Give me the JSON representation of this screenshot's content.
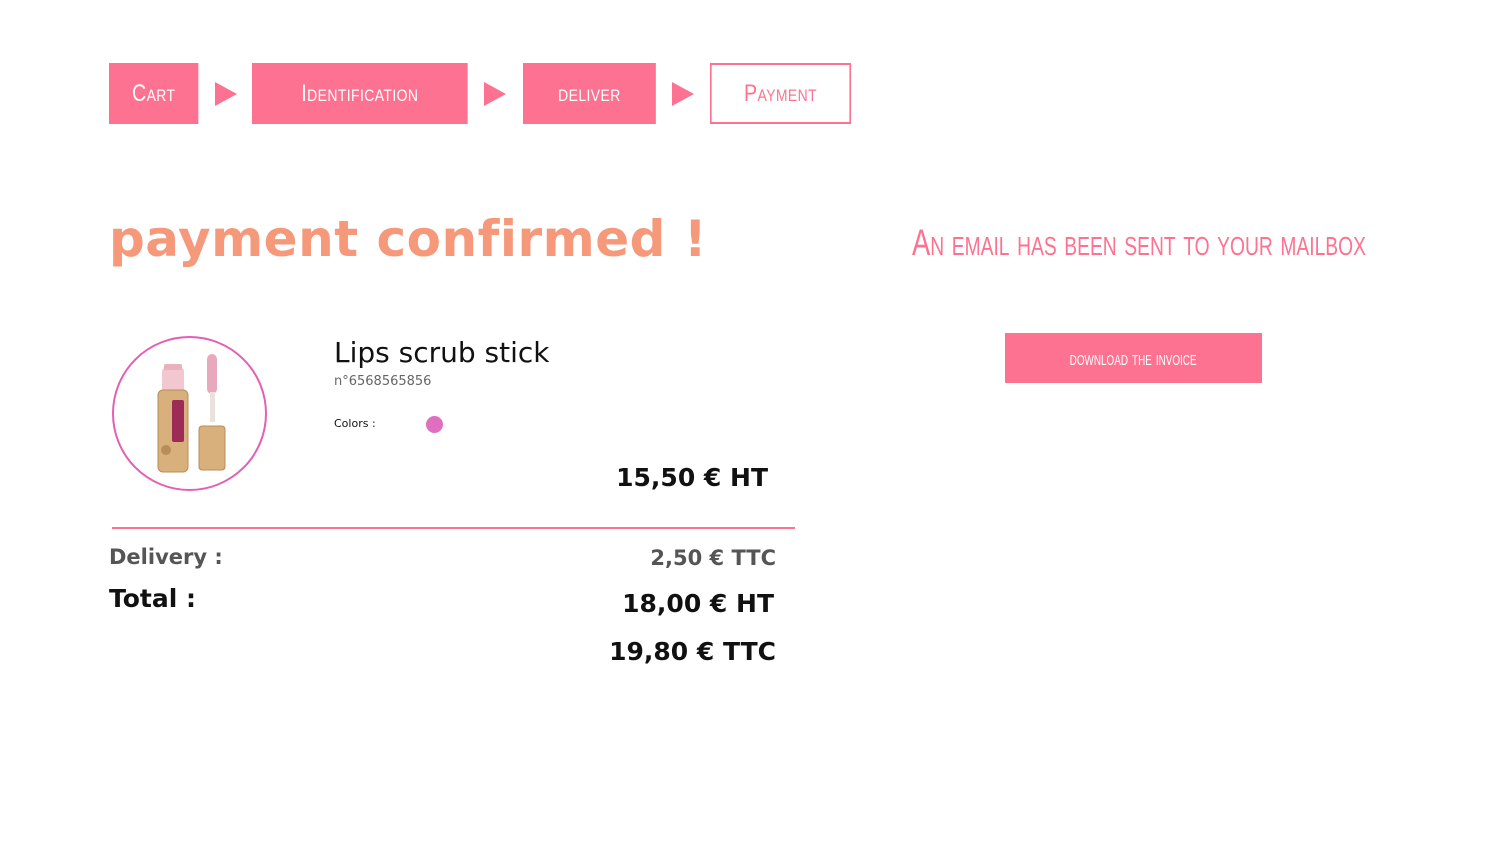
{
  "steps": [
    {
      "label": "Cart",
      "active": false
    },
    {
      "label": "Identification",
      "active": false
    },
    {
      "label": "deliver",
      "active": false
    },
    {
      "label": "Payment",
      "active": true
    }
  ],
  "confirmation": {
    "title": "payment confirmed !",
    "email_notice": "An email has been sent to your mailbox",
    "download_label": "download the invoice"
  },
  "product": {
    "name": "Lips scrub stick",
    "reference": "n°6568565856",
    "colors_label": "Colors :",
    "color": "#e06fc0",
    "price": "15,50 € HT",
    "image_icon": "lip-gloss-bamboo-tube"
  },
  "totals": {
    "delivery_label": "Delivery :",
    "delivery_value": "2,50 € TTC",
    "total_label": "Total :",
    "total_ht": "18,00 € HT",
    "total_ttc": "19,80 € TTC"
  },
  "theme": {
    "accent": "#fd7290",
    "headline": "#f5997a",
    "thumb_border": "#e35fb6"
  }
}
